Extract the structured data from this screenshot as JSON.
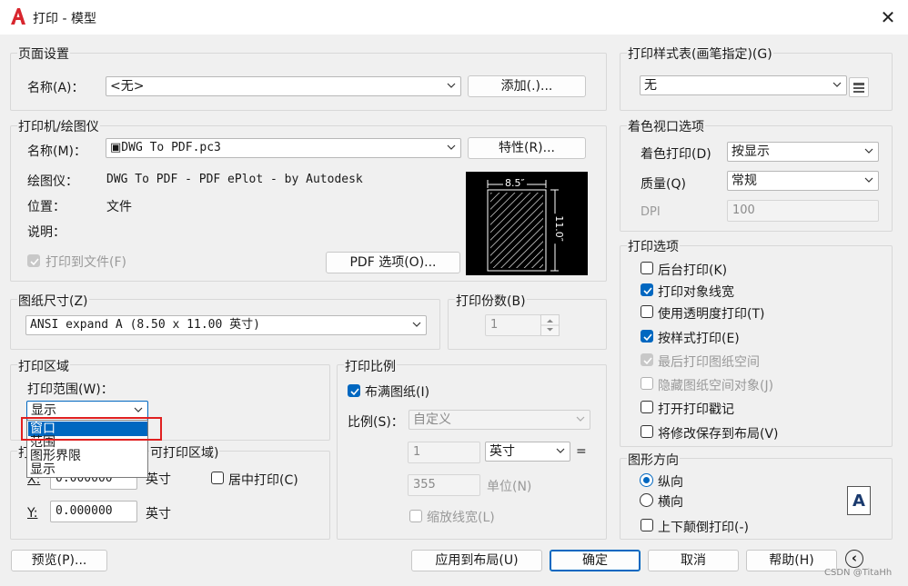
{
  "window": {
    "title": "打印 - 模型",
    "close": "✕"
  },
  "page_setup": {
    "group": "页面设置",
    "name_label": "名称(A)：",
    "name_value": "<无>",
    "add_button": "添加(.)..."
  },
  "plotter": {
    "group": "打印机/绘图仪",
    "name_label": "名称(M)：",
    "name_value": "DWG To PDF.pc3",
    "properties_button": "特性(R)...",
    "plotter_label": "绘图仪：",
    "plotter_value": "DWG To PDF - PDF ePlot - by Autodesk",
    "location_label": "位置：",
    "location_value": "文件",
    "desc_label": "说明：",
    "plot_to_file": "打印到文件(F)",
    "pdf_options_button": "PDF 选项(O)...",
    "preview_width": "8.5″",
    "preview_height": "11.0″"
  },
  "paper_size": {
    "group": "图纸尺寸(Z)",
    "value": "ANSI expand A (8.50 x 11.00 英寸)"
  },
  "copies": {
    "group": "打印份数(B)",
    "value": "1"
  },
  "plot_area": {
    "group": "打印区域",
    "range_label": "打印范围(W)：",
    "range_value": "显示",
    "options": [
      "窗口",
      "范围",
      "图形界限",
      "显示"
    ]
  },
  "plot_offset": {
    "group_hidden": "打",
    "group_suffix": "可打印区域)",
    "x_label": "X:",
    "x_value": "0.000000",
    "x_unit": "英寸",
    "y_label": "Y:",
    "y_value": "0.000000",
    "y_unit": "英寸",
    "center": "居中打印(C)"
  },
  "plot_scale": {
    "group": "打印比例",
    "fit_paper": "布满图纸(I)",
    "scale_label": "比例(S)：",
    "scale_value": "自定义",
    "val1": "1",
    "unit1": "英寸",
    "equals": "=",
    "val2": "355",
    "unit2": "单位(N)",
    "scale_lineweights": "缩放线宽(L)"
  },
  "style_table": {
    "group": "打印样式表(画笔指定)(G)",
    "value": "无"
  },
  "shaded": {
    "group": "着色视口选项",
    "shade_label": "着色打印(D)",
    "shade_value": "按显示",
    "quality_label": "质量(Q)",
    "quality_value": "常规",
    "dpi_label": "DPI",
    "dpi_value": "100"
  },
  "plot_options": {
    "group": "打印选项",
    "items": [
      "后台打印(K)",
      "打印对象线宽",
      "使用透明度打印(T)",
      "按样式打印(E)",
      "最后打印图纸空间",
      "隐藏图纸空间对象(J)",
      "打开打印戳记",
      "将修改保存到布局(V)"
    ]
  },
  "orientation": {
    "group": "图形方向",
    "portrait": "纵向",
    "landscape": "横向",
    "upside_down": "上下颠倒打印(-)",
    "glyph": "A"
  },
  "footer": {
    "preview": "预览(P)...",
    "apply_layout": "应用到布局(U)",
    "ok": "确定",
    "cancel": "取消",
    "help": "帮助(H)",
    "more": "‹"
  },
  "watermark": "CSDN @TitaHh",
  "colors": {
    "accent": "#0067c0",
    "highlight_box": "#e02020"
  }
}
